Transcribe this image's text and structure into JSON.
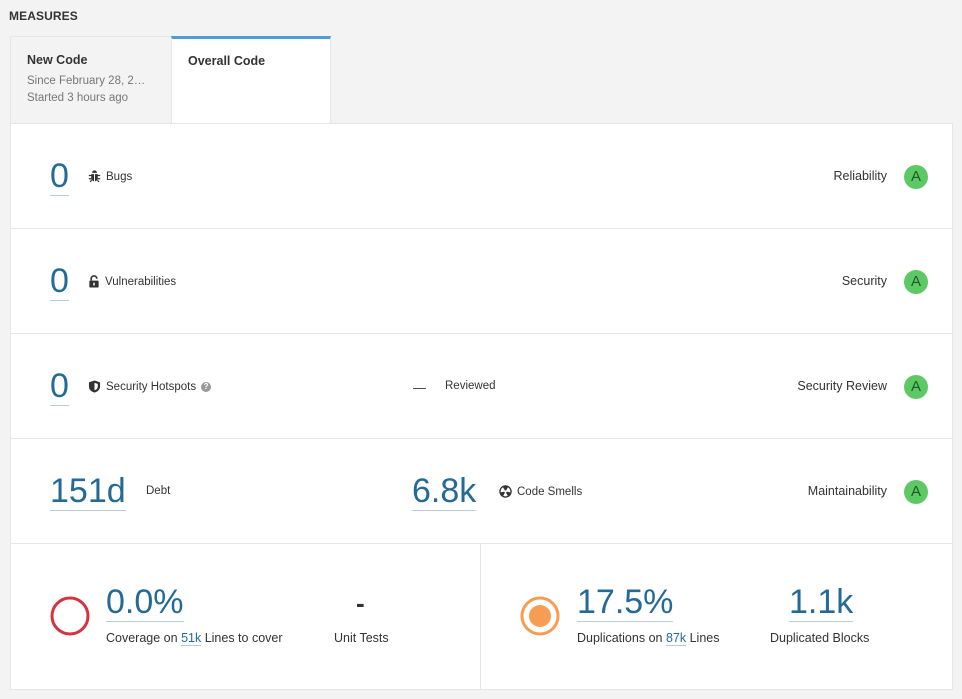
{
  "header": {
    "title": "MEASURES"
  },
  "tabs": {
    "new_code": {
      "title": "New Code",
      "since": "Since February 28, 2…",
      "started": "Started 3 hours ago"
    },
    "overall_code": {
      "title": "Overall Code"
    }
  },
  "rows": {
    "bugs": {
      "value": "0",
      "label": "Bugs",
      "rating_label": "Reliability",
      "rating": "A",
      "icon": "bug-icon"
    },
    "vulnerabilities": {
      "value": "0",
      "label": "Vulnerabilities",
      "rating_label": "Security",
      "rating": "A",
      "icon": "lock-icon"
    },
    "hotspots": {
      "value": "0",
      "label": "Security Hotspots",
      "reviewed_value": "—",
      "reviewed_label": "Reviewed",
      "rating_label": "Security Review",
      "rating": "A",
      "icon": "shield-icon"
    },
    "maintainability": {
      "debt_value": "151d",
      "debt_label": "Debt",
      "smells_value": "6.8k",
      "smells_label": "Code Smells",
      "rating_label": "Maintainability",
      "rating": "A",
      "icon": "code-smell-icon"
    }
  },
  "coverage": {
    "value": "0.0%",
    "prefix": "Coverage on",
    "lines": "51k",
    "suffix": "Lines to cover",
    "unit_tests_value": "-",
    "unit_tests_label": "Unit Tests",
    "ring_color": "#d4333f"
  },
  "duplications": {
    "value": "17.5%",
    "prefix": "Duplications on",
    "lines": "87k",
    "suffix": "Lines",
    "blocks_value": "1.1k",
    "blocks_label": "Duplicated Blocks",
    "ring_color": "#f69d53"
  },
  "colors": {
    "accent": "#4b9fd5",
    "link": "#236a97",
    "rating_a": "#5dc964"
  }
}
